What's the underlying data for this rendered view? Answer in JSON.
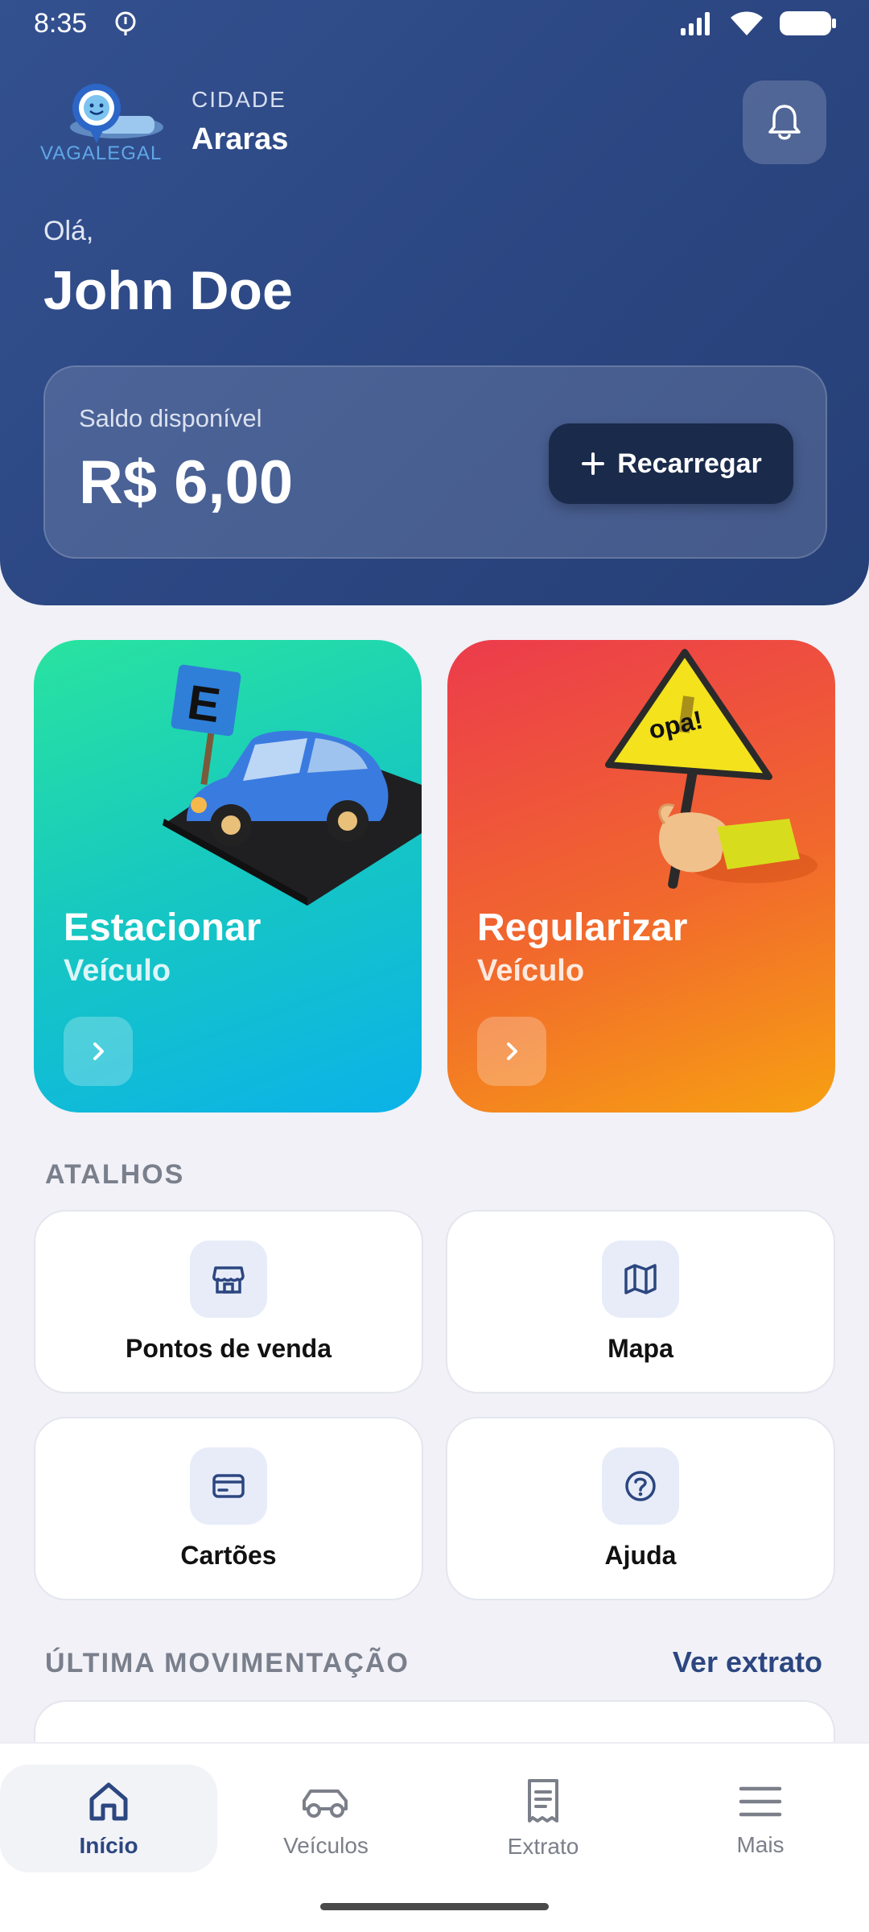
{
  "status_bar": {
    "time": "8:35"
  },
  "header": {
    "logo_text": "VAGALEGAL",
    "city_label": "CIDADE",
    "city_name": "Araras",
    "greeting": "Olá,",
    "user_name": "John Doe"
  },
  "balance": {
    "label": "Saldo disponível",
    "value": "R$ 6,00",
    "recharge_label": "Recarregar"
  },
  "actions": [
    {
      "title": "Estacionar",
      "subtitle": "Veículo",
      "sign_letter": "E"
    },
    {
      "title": "Regularizar",
      "subtitle": "Veículo",
      "sign_text": "opa!"
    }
  ],
  "shortcuts": {
    "title": "ATALHOS",
    "items": [
      {
        "label": "Pontos de venda",
        "icon": "store-icon"
      },
      {
        "label": "Mapa",
        "icon": "map-icon"
      },
      {
        "label": "Cartões",
        "icon": "credit-card-icon"
      },
      {
        "label": "Ajuda",
        "icon": "help-icon"
      }
    ]
  },
  "last_movement": {
    "title": "ÚLTIMA MOVIMENTAÇÃO",
    "link": "Ver extrato"
  },
  "nav": [
    {
      "label": "Início",
      "icon": "home-icon",
      "active": true
    },
    {
      "label": "Veículos",
      "icon": "car-icon",
      "active": false
    },
    {
      "label": "Extrato",
      "icon": "receipt-icon",
      "active": false
    },
    {
      "label": "Mais",
      "icon": "menu-icon",
      "active": false
    }
  ],
  "colors": {
    "header": "#2b4681",
    "primary": "#2c4680",
    "park_card": "#16c7c2",
    "regularize_card": "#f1682d"
  }
}
